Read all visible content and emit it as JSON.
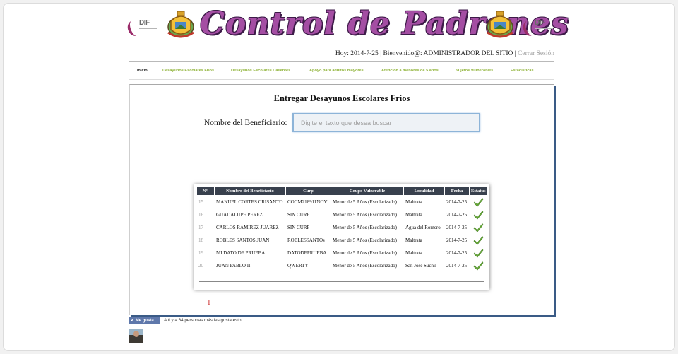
{
  "header": {
    "title": "Control de Padrones",
    "dif_logo_text": "DIF"
  },
  "userbar": {
    "prefix": "| Hoy: ",
    "date": "2014-7-25",
    "welcome": " | Bienvenido@: ",
    "user": "ADMINISTRADOR DEL SITIO",
    "sep": " | ",
    "logout": "Cerrar Sesión"
  },
  "nav": {
    "items": [
      {
        "label": "Inicio"
      },
      {
        "label": "Desayunos Escolares Frios"
      },
      {
        "label": "Desayunos Escolares Calientes"
      },
      {
        "label": "Apoyo para adultos mayores"
      },
      {
        "label": "Atencion a menores de 5 años"
      },
      {
        "label": "Sujetos Vulnerables"
      },
      {
        "label": "Estadisticas"
      }
    ]
  },
  "main": {
    "title": "Entregar Desayunos Escolares Frios",
    "search_label": "Nombre del Beneficiario:",
    "search_placeholder": "Digite el texto que desea buscar"
  },
  "table": {
    "headers": [
      "Nº.",
      "Nombre del Beneficiario",
      "Curp",
      "Grupo Vulnerable",
      "Localidad",
      "Fecha",
      "Estatus"
    ],
    "rows": [
      {
        "n": "15",
        "name": "MANUEL CORTES CRISANTO",
        "curp": "COCM218911NOV",
        "group": "Menor de 5 Años (Escolarizado)",
        "loc": "Maltrata",
        "date": "2014-7-25"
      },
      {
        "n": "16",
        "name": "GUADALUPE PEREZ",
        "curp": "SIN CURP",
        "group": "Menor de 5 Años (Escolarizado)",
        "loc": "Maltrata",
        "date": "2014-7-25"
      },
      {
        "n": "17",
        "name": "CARLOS RAMIREZ JUAREZ",
        "curp": "SIN CURP",
        "group": "Menor de 5 Años (Escolarizado)",
        "loc": "Agua del Romero",
        "date": "2014-7-25"
      },
      {
        "n": "18",
        "name": "ROBLES SANTOS JUAN",
        "curp": "ROBLESSANTOs",
        "group": "Menor de 5 Años (Escolarizado)",
        "loc": "Maltrata",
        "date": "2014-7-25"
      },
      {
        "n": "19",
        "name": "MI DATO DE PRUEBA",
        "curp": "DATODEPRUEBA",
        "group": "Menor de 5 Años (Escolarizado)",
        "loc": "Maltrata",
        "date": "2014-7-25"
      },
      {
        "n": "20",
        "name": "JUAN PABLO II",
        "curp": "QWERTY",
        "group": "Menor de 5 Años (Escolarizado)",
        "loc": "San José Súchil",
        "date": "2014-7-25"
      }
    ],
    "status_icon": "check-icon",
    "status_color": "#6fb33a"
  },
  "pager": {
    "page": "1"
  },
  "like": {
    "button": "✔ Me gusta",
    "text": "A ti y a 64 personas más les gusta esto."
  },
  "colors": {
    "title_purple": "#a44ea3",
    "nav_green": "#8fb338",
    "table_header": "#38404d",
    "panel_shadow": "#3a5b86",
    "pager_red": "#cc2a2a"
  }
}
